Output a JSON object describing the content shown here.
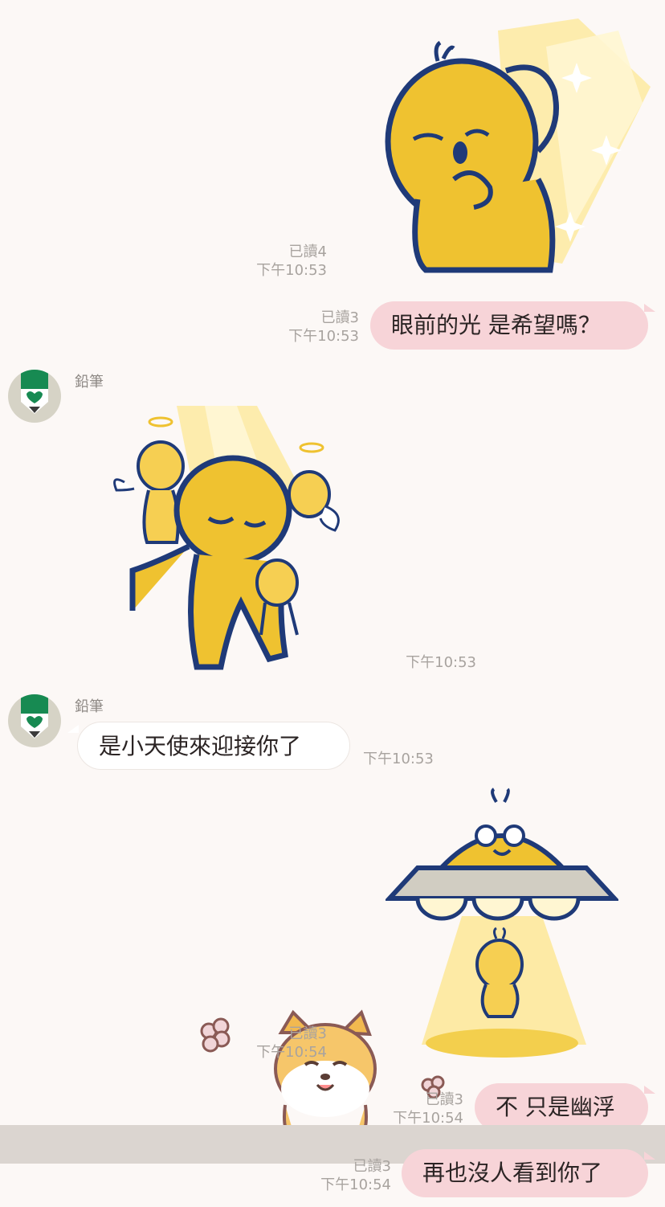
{
  "messages": [
    {
      "type": "sticker",
      "side": "out",
      "read": "已讀4",
      "time": "下午10:53"
    },
    {
      "type": "text",
      "side": "out",
      "read": "已讀3",
      "time": "下午10:53",
      "text": "眼前的光 是希望嗎？"
    },
    {
      "type": "sticker",
      "side": "in",
      "sender": "鉛筆",
      "time": "下午10:53"
    },
    {
      "type": "text",
      "side": "in",
      "sender": "鉛筆",
      "time": "下午10:53",
      "text": "是小天使來迎接你了"
    },
    {
      "type": "sticker",
      "side": "out",
      "read": "已讀3",
      "time": "下午10:54"
    },
    {
      "type": "text",
      "side": "out",
      "read": "已讀3",
      "time": "下午10:54",
      "text": "不 只是幽浮"
    },
    {
      "type": "text",
      "side": "out",
      "read": "已讀3",
      "time": "下午10:54",
      "text": "再也沒人看到你了"
    }
  ],
  "colors": {
    "background": "#fcf8f6",
    "outgoing_bubble": "#f7d4d8",
    "incoming_bubble": "#ffffff",
    "meta_text": "#a8a39f",
    "sticker_yellow": "#efc230",
    "sticker_outline": "#1f3a78",
    "avatar_green": "#178a52"
  },
  "icons": [
    "pencil-avatar-icon",
    "sparkle-icon",
    "halo-icon",
    "flower-icon"
  ]
}
